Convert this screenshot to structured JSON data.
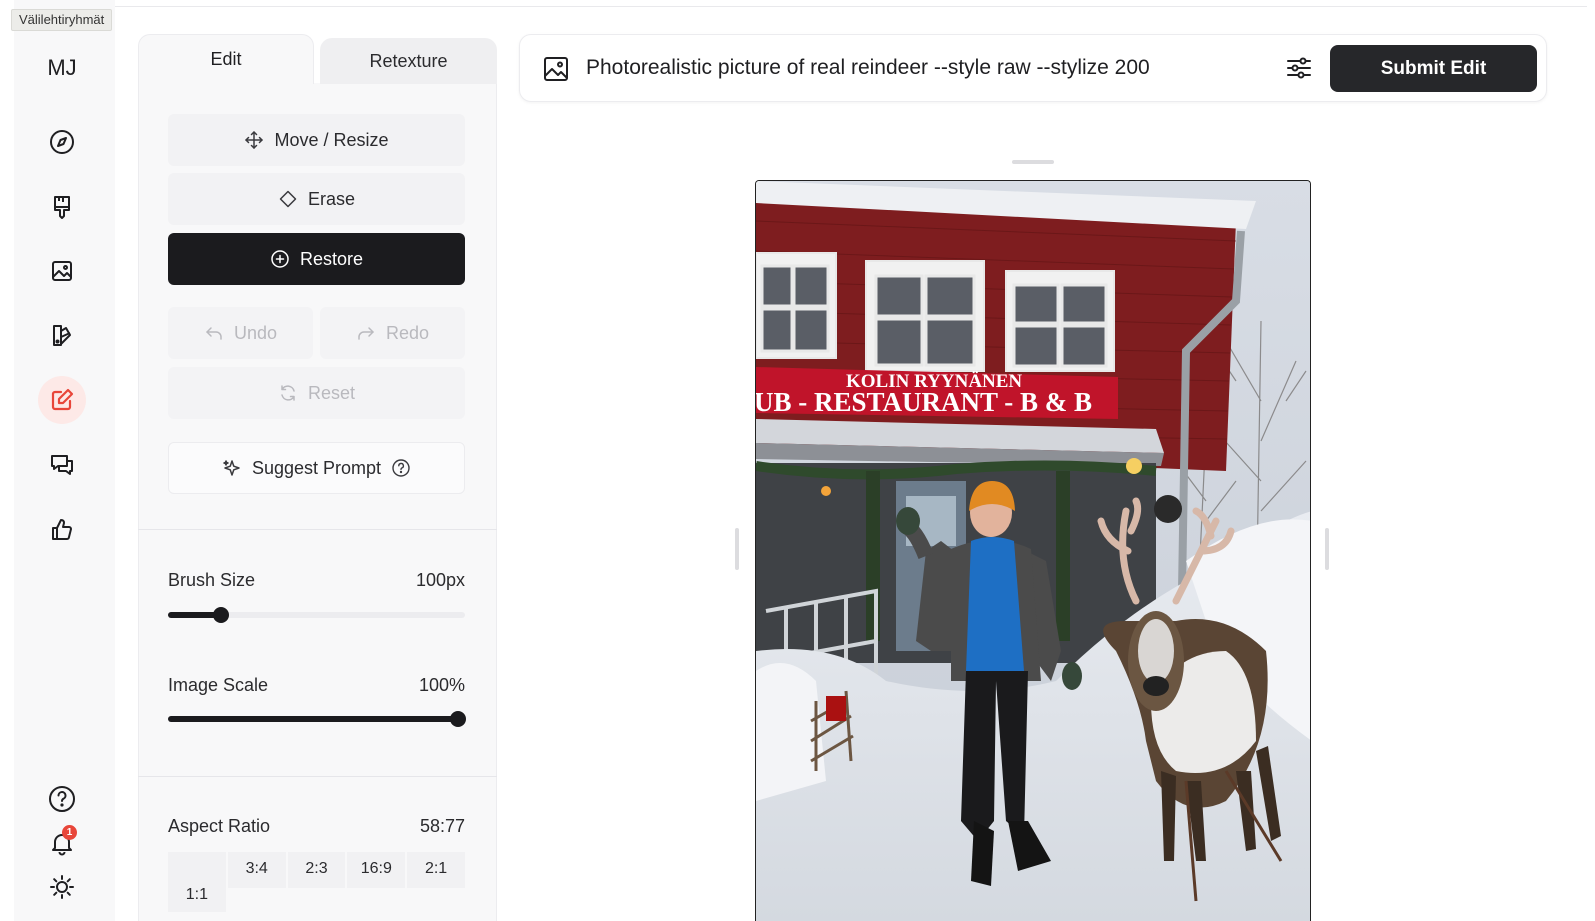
{
  "tooltip": "Välilehtiryhmät",
  "sidebar": {
    "logo": "MJ",
    "icons": [
      "compass-icon",
      "paintbrush-icon",
      "image-icon",
      "palette-icon",
      "edit-icon",
      "chat-icon",
      "thumbs-up-icon"
    ],
    "active": "edit-icon",
    "accent_color": "#e8463a",
    "bottom_icons": [
      "help-icon",
      "bell-icon",
      "sun-icon"
    ],
    "notification_count": "1"
  },
  "tabs": {
    "edit": "Edit",
    "retexture": "Retexture"
  },
  "tools": {
    "move_resize": "Move / Resize",
    "erase": "Erase",
    "restore": "Restore",
    "undo": "Undo",
    "redo": "Redo",
    "reset": "Reset",
    "suggest_prompt": "Suggest Prompt"
  },
  "brush": {
    "label": "Brush Size",
    "value": "100px",
    "fraction": 0.18
  },
  "scale": {
    "label": "Image Scale",
    "value": "100%",
    "fraction": 0.975
  },
  "aspect": {
    "label": "Aspect Ratio",
    "value": "58:77",
    "options": [
      "1:1",
      "3:4",
      "2:3",
      "16:9",
      "2:1"
    ]
  },
  "prompt": {
    "text": "Photorealistic picture of real reindeer --style raw --stylize 200",
    "submit_label": "Submit Edit"
  },
  "image": {
    "sign_line1": "KOLIN RYYNÄNEN",
    "sign_line2": "UB - RESTAURANT - B & B"
  }
}
